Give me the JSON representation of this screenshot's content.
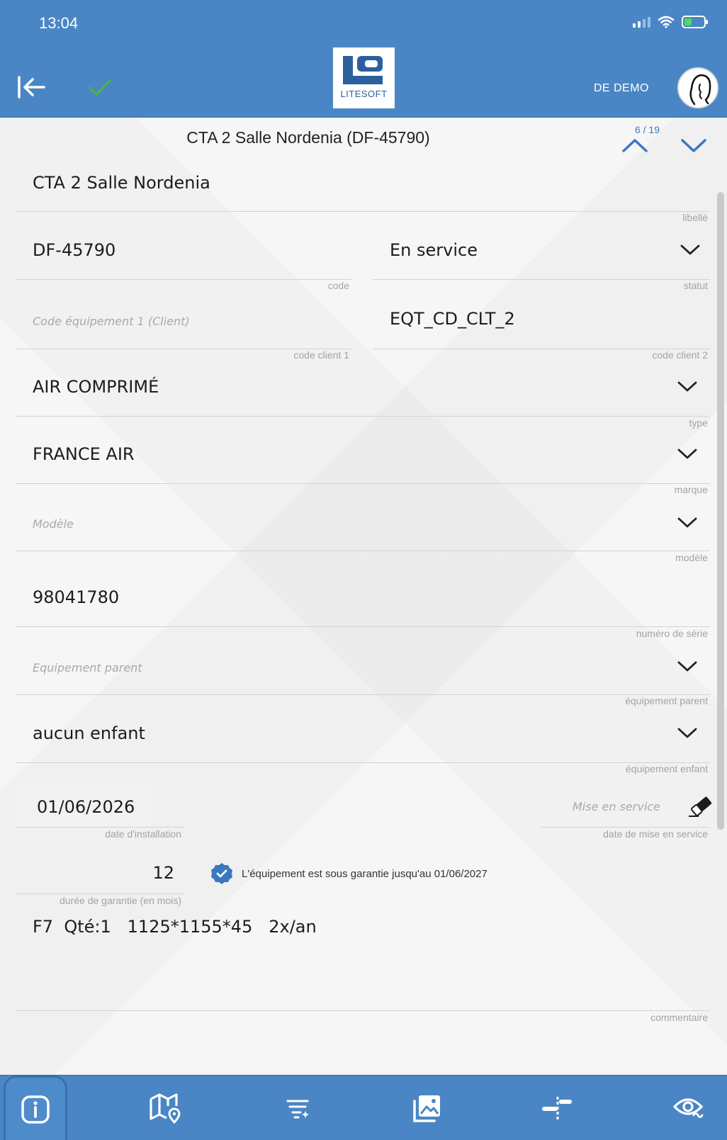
{
  "status_bar": {
    "time": "13:04"
  },
  "header": {
    "logo_text": "LITESOFT",
    "user_name": "DE DEMO"
  },
  "record": {
    "title": "CTA 2 Salle Nordenia (DF-45790)",
    "pager": "6 / 19"
  },
  "form": {
    "libelle": {
      "value": "CTA 2 Salle Nordenia",
      "caption": "libellé"
    },
    "code": {
      "value": "DF-45790",
      "caption": "code"
    },
    "statut": {
      "value": "En service",
      "caption": "statut"
    },
    "code_client_1": {
      "placeholder": "Code équipement 1 (Client)",
      "caption": "code client 1"
    },
    "code_client_2": {
      "value": "EQT_CD_CLT_2",
      "caption": "code client 2"
    },
    "type": {
      "value": "AIR COMPRIMÉ",
      "caption": "type"
    },
    "marque": {
      "value": "FRANCE AIR",
      "caption": "marque"
    },
    "modele": {
      "placeholder": "Modèle",
      "caption": "modèle"
    },
    "numero_serie": {
      "value": "98041780",
      "caption": "numéro de série"
    },
    "equipement_parent": {
      "placeholder": "Equipement parent",
      "caption": "équipement parent"
    },
    "equipement_enfant": {
      "value": "aucun enfant",
      "caption": "équipement enfant"
    },
    "date_installation": {
      "value": "01/06/2026",
      "caption": "date d'installation"
    },
    "date_mise_service": {
      "placeholder": "Mise en service",
      "caption": "date de mise en service"
    },
    "duree_garantie": {
      "value": "12",
      "caption": "durée de garantie (en mois)"
    },
    "warranty_text": "L'équipement est sous garantie jusqu'au 01/06/2027",
    "commentaire": {
      "value": "F7  Qté:1   1125*1155*45   2x/an",
      "caption": "commentaire"
    }
  },
  "colors": {
    "primary": "#4a86c5",
    "accent_blue": "#3a78c0",
    "check_green": "#4caf50"
  },
  "tabs": [
    {
      "icon": "info-icon",
      "active": true
    },
    {
      "icon": "map-pin-icon",
      "active": false
    },
    {
      "icon": "filter-list-icon",
      "active": false
    },
    {
      "icon": "gallery-icon",
      "active": false
    },
    {
      "icon": "measure-icon",
      "active": false
    },
    {
      "icon": "eye-icon",
      "active": false
    }
  ]
}
